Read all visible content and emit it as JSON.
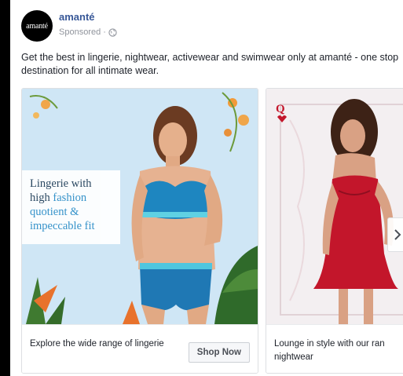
{
  "post": {
    "page_name": "amanté",
    "avatar_text": "amanté",
    "sponsored_label": "Sponsored ·",
    "caption": "Get the best in lingerie, nightwear, activewear and swimwear only at amanté - one stop destination for all intimate wear."
  },
  "carousel": {
    "cards": [
      {
        "overlay_lines": [
          "Lingerie with",
          "high",
          "fashion",
          "quotient &",
          "impeccable fit"
        ],
        "title": "Explore the wide range of lingerie",
        "cta": "Shop Now"
      },
      {
        "title": "Lounge in style with our ran nightwear",
        "card_mark": "Q"
      }
    ]
  },
  "colors": {
    "link_blue": "#385898",
    "card1_bg": "#cfe6f5",
    "bra_blue": "#1e86c0",
    "dress_red": "#c3162b"
  },
  "icons": [
    "globe-icon",
    "chevron-right-icon",
    "queen-card-icon",
    "flower-decoration-icon",
    "palm-leaf-icon"
  ]
}
